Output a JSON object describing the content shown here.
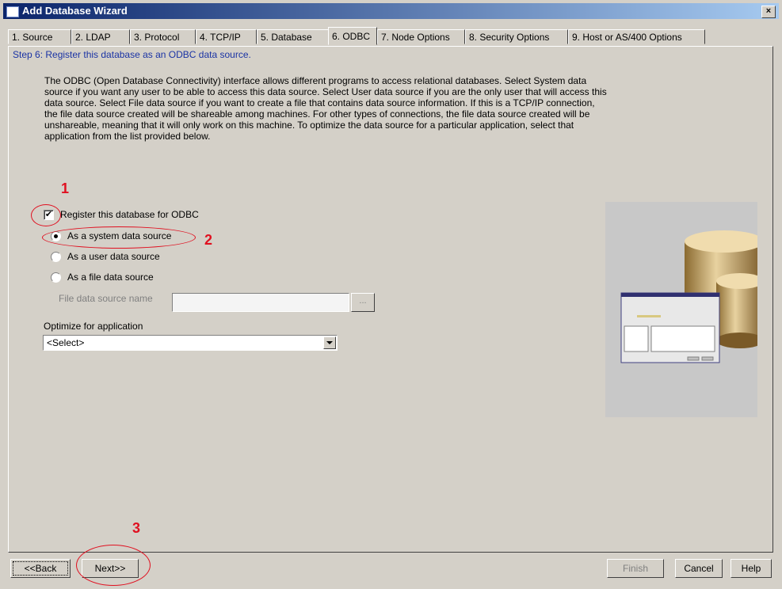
{
  "window": {
    "title": "Add Database Wizard",
    "close_glyph": "×"
  },
  "tabs": [
    {
      "label": "1. Source",
      "active": false
    },
    {
      "label": "2. LDAP",
      "active": false
    },
    {
      "label": "3. Protocol",
      "active": false
    },
    {
      "label": "4. TCP/IP",
      "active": false
    },
    {
      "label": "5. Database",
      "active": false
    },
    {
      "label": "6. ODBC",
      "active": true
    },
    {
      "label": "7. Node Options",
      "active": false
    },
    {
      "label": "8. Security Options",
      "active": false
    },
    {
      "label": "9. Host or AS/400 Options",
      "active": false
    }
  ],
  "step": "Step 6: Register this database as an ODBC data source.",
  "description": "The ODBC (Open Database Connectivity) interface allows different programs to access relational databases. Select System data source if you want any user to be able to access this data source.  Select User data source if you are the only user that will access this data source. Select File data source if you want to create a file that contains data source information.   If this is a TCP/IP connection, the file data source created will be shareable among machines. For other types of connections, the file data source created will be unshareable, meaning that it will only work on this machine.   To optimize the data source for a particular application, select that application from the list provided below.",
  "register": {
    "label": "Register this database for ODBC",
    "checked": true
  },
  "radios": {
    "system": {
      "label": "As a system data source",
      "selected": true
    },
    "user": {
      "label": "As a user data source",
      "selected": false
    },
    "file": {
      "label": "As a file data source",
      "selected": false
    }
  },
  "file_dsn": {
    "label": "File data source name",
    "value": "",
    "browse_label": "..."
  },
  "optimize": {
    "label": "Optimize for application",
    "selected": "<Select>"
  },
  "buttons": {
    "back": "<<Back",
    "next": "Next>>",
    "finish": "Finish",
    "cancel": "Cancel",
    "help": "Help"
  },
  "annotations": {
    "one": "1",
    "two": "2",
    "three": "3"
  },
  "colors": {
    "dialog_bg": "#d4d0c8",
    "title_bar": "#0a246a",
    "step_text": "#1a33a4",
    "annotation": "#e01020"
  }
}
